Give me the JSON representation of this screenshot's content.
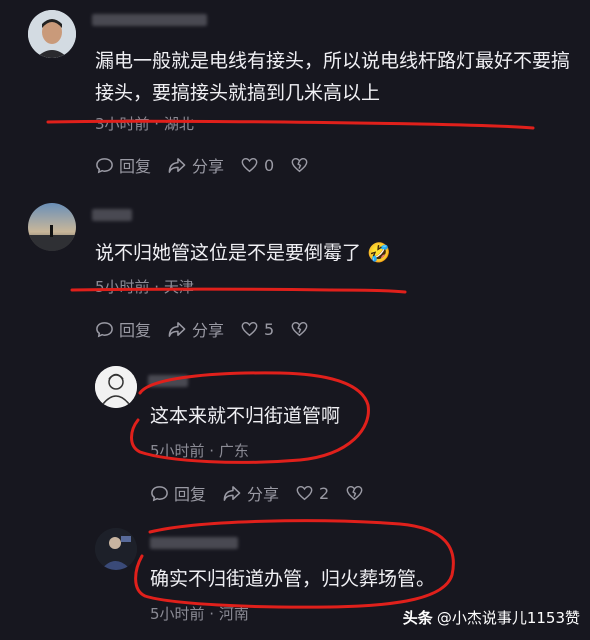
{
  "comments": [
    {
      "text_line1": "漏电一般就是电线有接头，所以说电线杆路灯最好不要搞",
      "text_line2": "接头，要搞接头就搞到几米高以上",
      "meta": "3小时前 · 湖北",
      "reply_label": "回复",
      "share_label": "分享",
      "like_count": "0"
    },
    {
      "text_line1": "说不归她管这位是不是要倒霉了 🤣",
      "meta": "5小时前 · 天津",
      "reply_label": "回复",
      "share_label": "分享",
      "like_count": "5"
    },
    {
      "text_line1": "这本来就不归街道管啊",
      "meta": "5小时前 · 广东",
      "reply_label": "回复",
      "share_label": "分享",
      "like_count": "2"
    },
    {
      "text_line1": "确实不归街道办管，归火葬场管。",
      "meta": "5小时前 · 河南"
    }
  ],
  "watermark": {
    "brand": "头条",
    "author": "@小杰说事儿1153赞"
  },
  "colors": {
    "background": "#17171f",
    "annotation_red": "#e0201b"
  }
}
